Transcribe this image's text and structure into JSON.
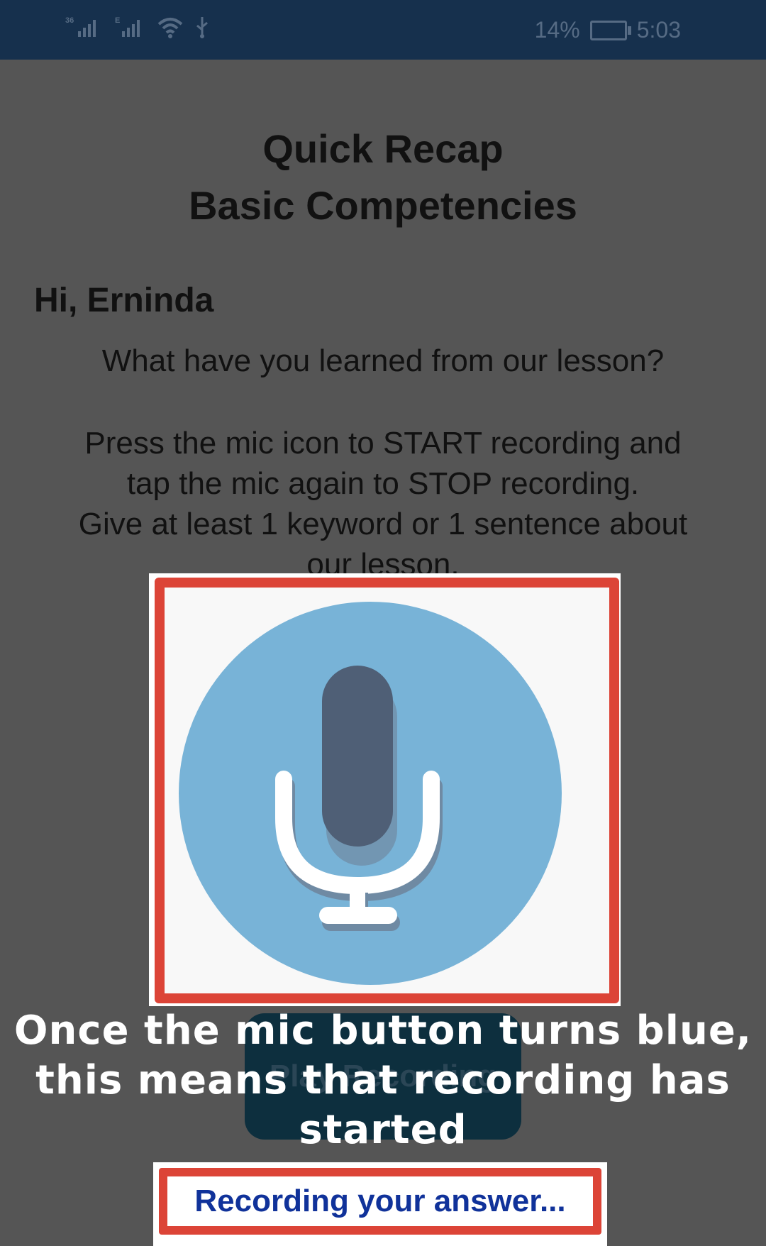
{
  "status_bar": {
    "net1": "36",
    "net2": "E",
    "battery_percent": "14%",
    "time": "5:03"
  },
  "header": {
    "title_line1": "Quick Recap",
    "title_line2": "Basic Competencies"
  },
  "content": {
    "greeting": "Hi, Erninda",
    "question": "What have you learned from our lesson?",
    "instruction_line1": "Press the mic icon to START recording and",
    "instruction_line2": "tap the mic again to STOP recording.",
    "instruction_line3": "Give at least 1 keyword or 1 sentence about",
    "instruction_line4": "our lesson."
  },
  "controls": {
    "play_recording_label": "Play Recording",
    "mic_icon": "microphone-icon",
    "mic_color": "#78b3d7"
  },
  "overlay": {
    "caption_line1": "Once the mic button turns blue,",
    "caption_line2": "this means that recording has",
    "caption_line3": "started",
    "highlight_color": "#dc4437"
  },
  "recording_status": {
    "text": "Recording your answer..."
  }
}
